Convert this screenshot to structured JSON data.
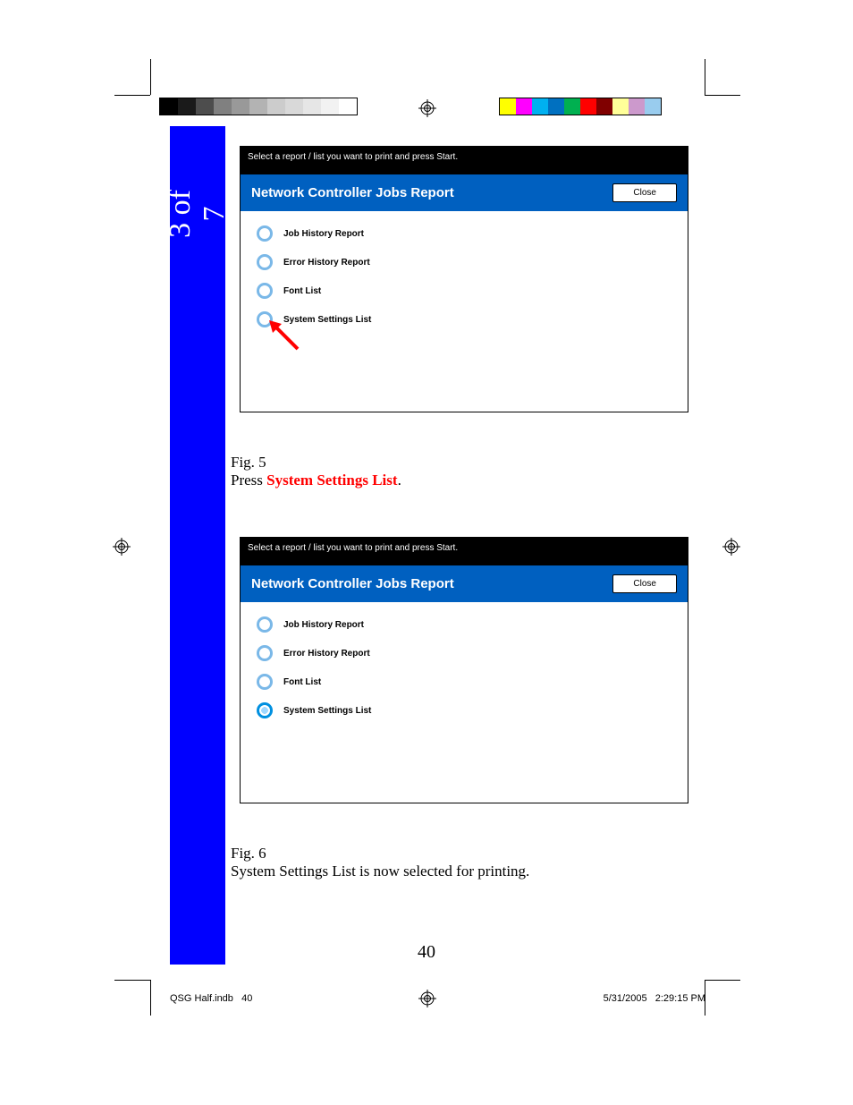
{
  "sidebar": {
    "page_of": "3 of 7",
    "section_title": "System Settings List"
  },
  "shot": {
    "instruction": "Select a report / list you want to print and press Start.",
    "header_title": "Network Controller Jobs Report",
    "close_label": "Close",
    "options": {
      "job_history": "Job History Report",
      "error_history": "Error History Report",
      "font_list": "Font List",
      "system_settings": "System Settings List"
    }
  },
  "captions": {
    "fig5_label": "Fig. 5",
    "fig5_prefix": "Press ",
    "fig5_highlight": "System Settings List",
    "fig5_suffix": ".",
    "fig6_label": "Fig. 6",
    "fig6_text": "System Settings List is now selected for printing."
  },
  "page_number": "40",
  "footer": {
    "left_file": "QSG Half.indb",
    "left_page": "40",
    "right_date": "5/31/2005",
    "right_time": "2:29:15 PM"
  },
  "calibration": {
    "grays": [
      "#000000",
      "#1a1a1a",
      "#4d4d4d",
      "#808080",
      "#999999",
      "#b3b3b3",
      "#cccccc",
      "#d9d9d9",
      "#e6e6e6",
      "#f2f2f2",
      "#ffffff"
    ],
    "colors": [
      "#ffff00",
      "#ff00ff",
      "#00b0f0",
      "#0070c0",
      "#00b050",
      "#ff0000",
      "#800000",
      "#ffff99",
      "#cc99cc",
      "#99ccee"
    ]
  }
}
